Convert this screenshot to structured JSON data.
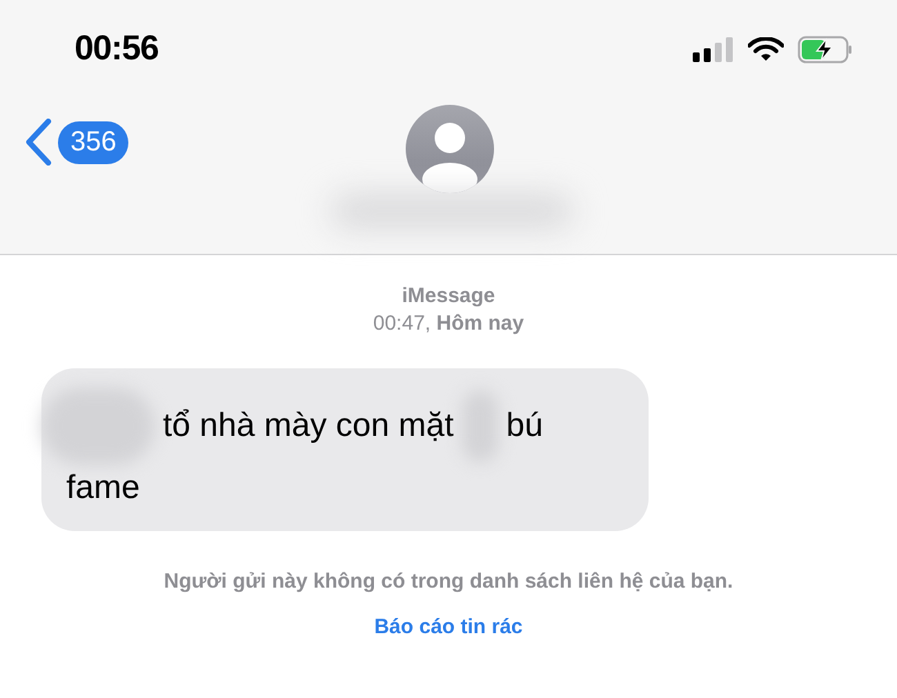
{
  "status_bar": {
    "time": "00:56",
    "battery": {
      "charging": true,
      "level": 0.55
    }
  },
  "header": {
    "back_count": "356",
    "contact_name_redacted": true
  },
  "conversation": {
    "service": "iMessage",
    "timestamp": "00:47, ",
    "timestamp_day": "Hôm nay",
    "message": {
      "lines": [
        [
          {
            "kind": "redacted"
          },
          {
            "kind": "text",
            "text": "tổ nhà mày con mặt"
          },
          {
            "kind": "redacted"
          },
          {
            "kind": "text",
            "text": "bú"
          }
        ],
        [
          {
            "kind": "text",
            "text": "fame"
          }
        ]
      ]
    },
    "notice": "Người gửi này không có trong danh sách liên hệ của bạn.",
    "report_link": "Báo cáo tin rác"
  }
}
